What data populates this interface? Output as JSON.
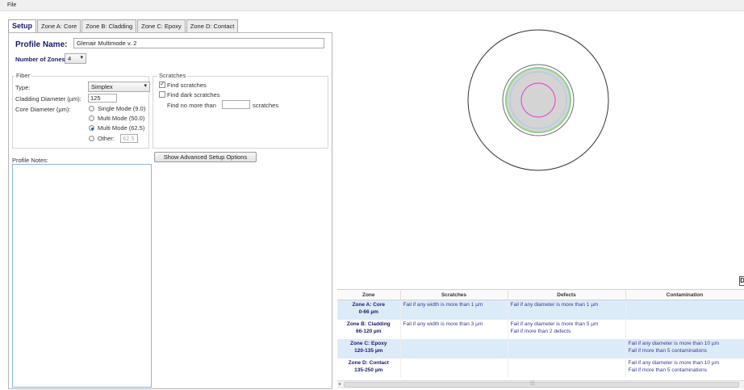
{
  "menu": {
    "file": "File"
  },
  "tabs": [
    "Setup",
    "Zone A: Core",
    "Zone B: Cladding",
    "Zone C: Epoxy",
    "Zone D: Contact"
  ],
  "setup": {
    "profile_name_label": "Profile Name:",
    "profile_name_value": "Glenair Multimode v. 2",
    "num_zones_label": "Number of Zones:",
    "num_zones_value": "4",
    "fiber": {
      "title": "Fiber",
      "type_label": "Type:",
      "type_value": "Simplex",
      "cladding_label": "Cladding Diameter (µm):",
      "cladding_value": "125",
      "core_label": "Core Diameter (µm):",
      "options": [
        "Single Mode (9.0)",
        "Multi Mode (50.0)",
        "Multi Mode (62.5)",
        "Other:"
      ],
      "selected_index": 2,
      "other_value": "62.5"
    },
    "scratches": {
      "title": "Scratches",
      "find_scratches": "Find scratches",
      "find_scratches_checked": true,
      "find_dark": "Find dark scratches",
      "find_dark_checked": false,
      "find_no_more_than": "Find no more than",
      "scratches_suffix": "scratches",
      "limit_value": ""
    },
    "advanced_button": "Show Advanced Setup Options",
    "notes_label": "Profile Notes:",
    "notes_value": ""
  },
  "viewer": {
    "right_tab": "D"
  },
  "zones_table": {
    "headers": [
      "Zone",
      "Scratches",
      "Defects",
      "Contamination"
    ],
    "rows": [
      {
        "zone": "Zone A: Core",
        "range": "0-66 µm",
        "scratches": "Fail if any width is more than 1 µm",
        "defects": [
          "Fail if any diameter is more than 1 µm"
        ],
        "contamination": []
      },
      {
        "zone": "Zone B: Cladding",
        "range": "66-120 µm",
        "scratches": "Fail if any width is more than 3 µm",
        "defects": [
          "Fail if any diameter is more than 5 µm",
          "Fail if more than 2 defects"
        ],
        "contamination": []
      },
      {
        "zone": "Zone C: Epoxy",
        "range": "120-135 µm",
        "scratches": "",
        "defects": [],
        "contamination": [
          "Fail if any diameter is more than 10 µm",
          "Fail if more than 5 contaminations"
        ]
      },
      {
        "zone": "Zone D: Contact",
        "range": "135-250 µm",
        "scratches": "",
        "defects": [],
        "contamination": [
          "Fail if any diameter is more than 10 µm",
          "Fail if more than 5 contaminations"
        ]
      }
    ]
  },
  "colors": {
    "accent": "#1a1a66",
    "row_highlight": "#dcebf8",
    "ring_green": "#8fd18f",
    "ring_magenta": "#e055d0",
    "zone_fill": "#d4d4d4"
  }
}
